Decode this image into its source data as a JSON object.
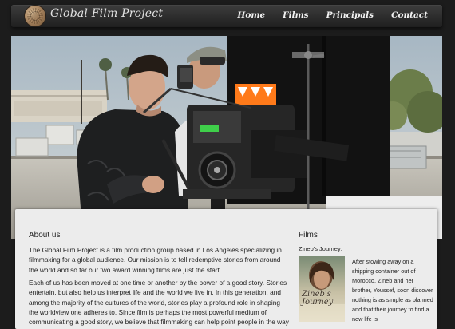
{
  "header": {
    "brand": "Global Film Project",
    "nav": [
      "Home",
      "Films",
      "Principals",
      "Contact"
    ]
  },
  "about": {
    "heading": "About us",
    "paragraphs": [
      "The Global Film Project is a film production group based in Los Angeles specializing in filmmaking for a global audience. Our mission is to tell redemptive stories from around the world and so far our two award winning films are just the start.",
      "Each of us has been moved at one time or another by the power of a good story. Stories entertain, but also help us interpret life and the world we live in. In this generation, and among the majority of the cultures of the world, stories play a profound role in shaping the worldview one adheres to. Since film is perhaps the most powerful medium of communicating a good story, we believe that filmmaking can help point people in the way"
    ]
  },
  "films": {
    "heading": "Films",
    "featured": {
      "label": "Zineb's Journey:",
      "poster_title": "Zineb's Journey",
      "description": "After stowing away on a shipping container out of Morocco, Zineb and her brother, Youssef, soon discover nothing is as simple as planned and that their journey to find a new life is"
    }
  },
  "colors": {
    "page_background": "#1c1c1c",
    "navbar": "#2e2e2e",
    "content_panel": "#ececec"
  }
}
